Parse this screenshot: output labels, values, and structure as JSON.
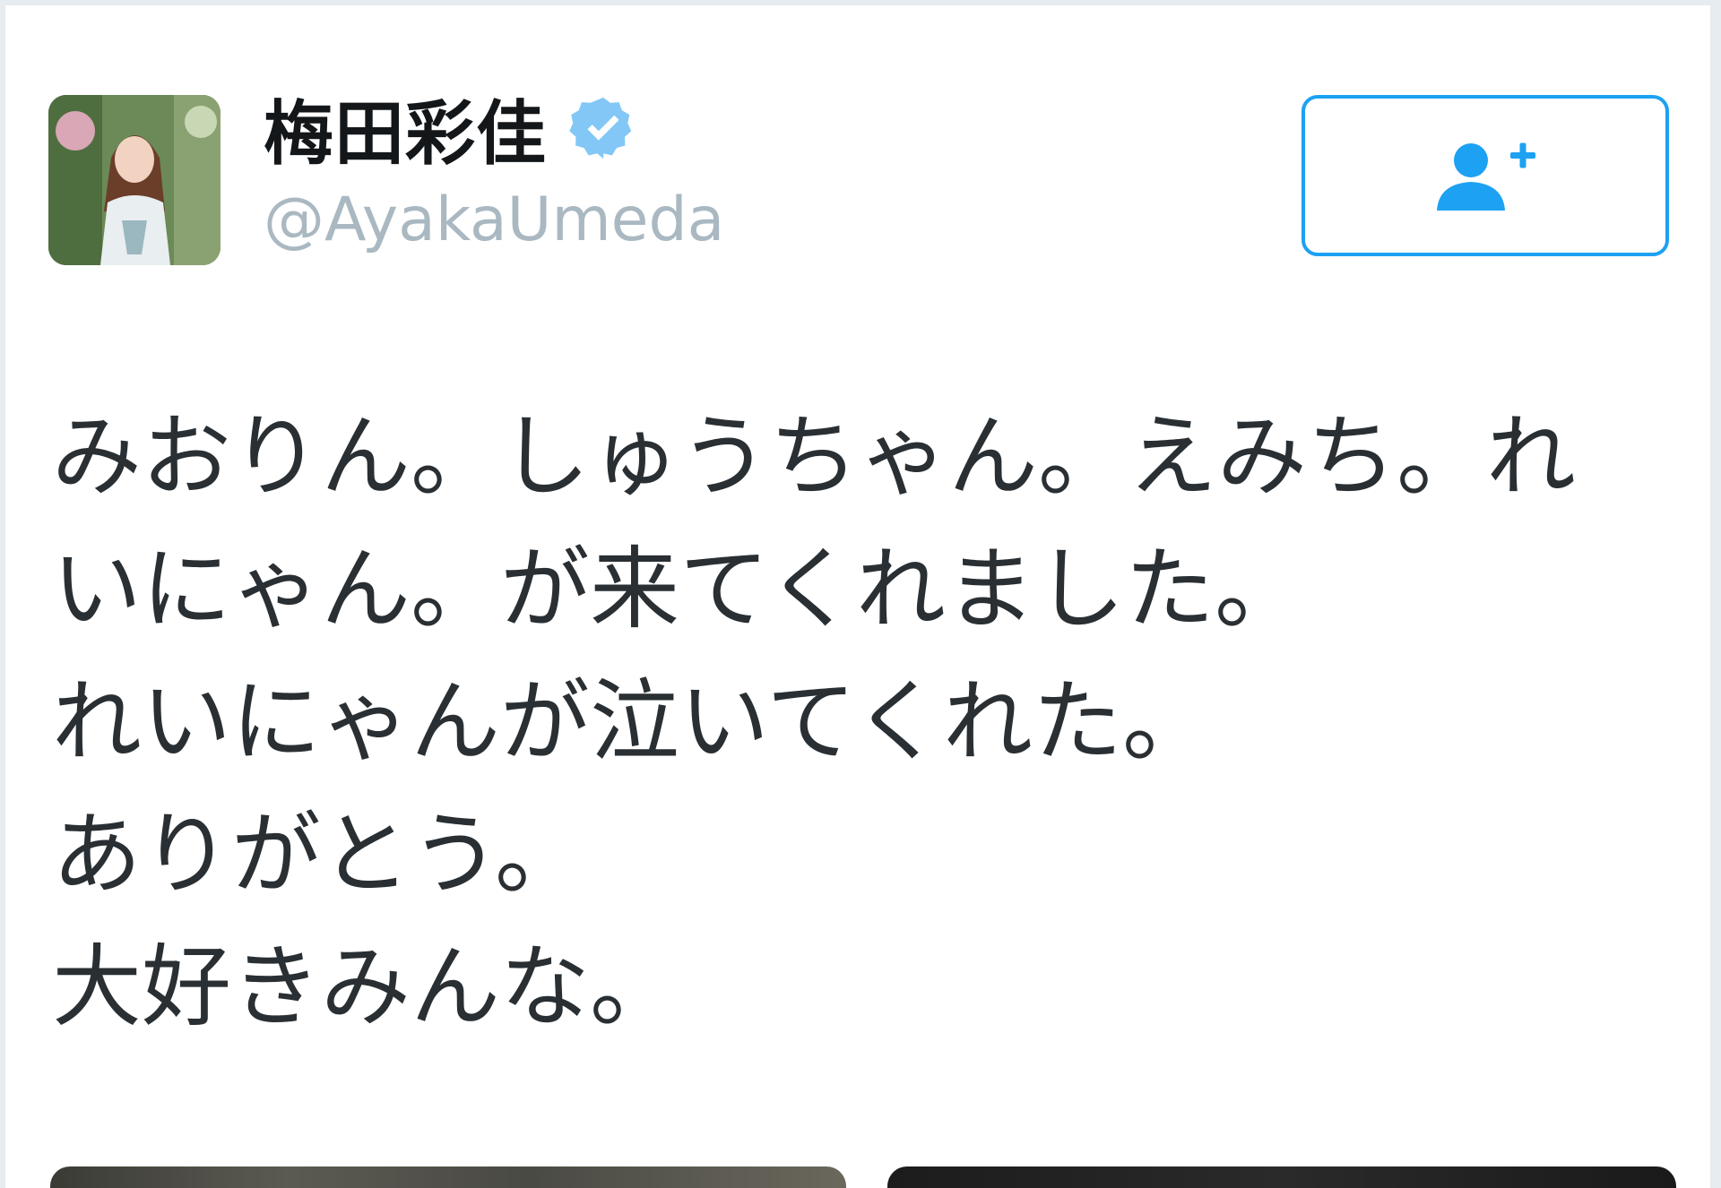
{
  "user": {
    "display_name": "梅田彩佳",
    "handle": "@AyakaUmeda",
    "verified": true,
    "avatar": "profile-photo"
  },
  "follow_button": {
    "icon": "follow-user-plus-icon"
  },
  "tweet": {
    "lines": [
      "みおりん。しゅうちゃん。えみち。れ",
      "いにゃん。が来てくれました。",
      "れいにゃんが泣いてくれた。",
      "ありがとう。",
      "大好きみんな。"
    ]
  },
  "colors": {
    "accent": "#1da1f2",
    "verified_badge": "#82c7f6",
    "handle": "#aab8c2",
    "text": "#292f33",
    "name": "#14171a"
  }
}
